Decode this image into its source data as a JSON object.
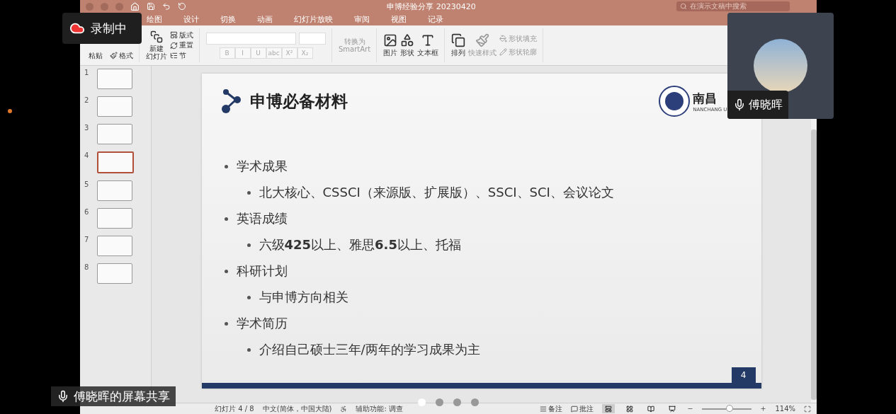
{
  "window": {
    "title": "申博经验分享 20230420",
    "search": {
      "placeholder": "在演示文稿中搜索"
    }
  },
  "ribbon_tabs": [
    {
      "label": "绘图",
      "selected": false
    },
    {
      "label": "设计",
      "selected": false
    },
    {
      "label": "切换",
      "selected": false
    },
    {
      "label": "动画",
      "selected": false
    },
    {
      "label": "幻灯片放映",
      "selected": false
    },
    {
      "label": "审阅",
      "selected": false
    },
    {
      "label": "视图",
      "selected": false
    },
    {
      "label": "记录",
      "selected": false
    }
  ],
  "ribbon": {
    "paste": "粘贴",
    "format": "格式",
    "new_slide": [
      "新建",
      "幻灯片"
    ],
    "layout": "版式",
    "reset": "重置",
    "section": "节",
    "format_buttons": [
      "B",
      "I",
      "U",
      "abc",
      "X²",
      "X₂"
    ],
    "smartart": [
      "转换为",
      "SmartArt"
    ],
    "picture": "图片",
    "shapes": "形状",
    "textbox": "文本框",
    "arrange": "排列",
    "quick_styles": "快速样式",
    "shape_fill": "形状填充",
    "shape_outline": "形状轮廓"
  },
  "thumbnails": [
    {
      "number": "1",
      "selected": false
    },
    {
      "number": "2",
      "selected": false
    },
    {
      "number": "3",
      "selected": false
    },
    {
      "number": "4",
      "selected": true
    },
    {
      "number": "5",
      "selected": false
    },
    {
      "number": "6",
      "selected": false
    },
    {
      "number": "7",
      "selected": false
    },
    {
      "number": "8",
      "selected": false
    }
  ],
  "slide": {
    "title": "申博必备材料",
    "logo_text": "南昌",
    "logo_subtext": "NANCHANG U",
    "page_number": "4",
    "bullets": [
      {
        "text": "学术成果",
        "children": [
          {
            "text": "北大核心、CSSCI（来源版、扩展版）、SSCI、SCI、会议论文"
          }
        ]
      },
      {
        "text": "英语成绩",
        "children": [
          {
            "text": "六级**425**以上、雅思**6.5**以上、托福"
          }
        ]
      },
      {
        "text": "科研计划",
        "children": [
          {
            "text": "与申博方向相关"
          }
        ]
      },
      {
        "text": "学术简历",
        "children": [
          {
            "text": "介绍自己硕士三年/两年的学习成果为主"
          }
        ]
      }
    ]
  },
  "status_bar": {
    "slide_count": "幻灯片 4 / 8",
    "language": "中文(简体，中国大陆)",
    "accessibility": "辅助功能: 调查",
    "notes": "备注",
    "comments": "批注",
    "zoom": "114%",
    "zoom_slider": {
      "level": 0.55
    }
  },
  "meeting": {
    "recording": "录制中",
    "participant": "傅晓晖",
    "share_label": "傅晓晖的屏幕共享",
    "pager": [
      {
        "selected": true
      },
      {
        "selected": false
      },
      {
        "selected": false
      },
      {
        "selected": false
      }
    ]
  }
}
